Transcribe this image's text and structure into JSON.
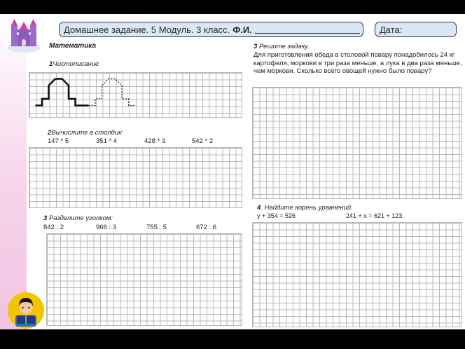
{
  "header": {
    "title_prefix": "Домашнее задание. 5 Модуль. 3 класс.",
    "name_label": "Ф.И.",
    "date_label": "Дата:"
  },
  "subject": "Математика",
  "task1": {
    "number": "1",
    "title": "Чистописание"
  },
  "task2": {
    "number": "2",
    "title": "Вычислите в столбик:",
    "expressions": [
      "147 * 5",
      "351 * 4",
      "428 * 3",
      "542 * 2"
    ]
  },
  "task3left": {
    "number": "3",
    "title": "Разделите уголком:",
    "expressions": [
      "842 : 2",
      "966 : 3",
      "755 : 5",
      "672 : 6"
    ]
  },
  "task3right": {
    "number": "3",
    "title": "Решите задачу.",
    "text": "Для приготовления обеда в столовой повару понадобилось 24 кг картофеля, моркови в три раза меньше, а лука в два раза меньше, чем моркови. Сколько всего овощей нужно было повару?"
  },
  "task4": {
    "number": "4",
    "title": "Найдите корень уравнений.",
    "equations": [
      "у + 354 = 526",
      "241 + х = 621 + 123"
    ]
  },
  "colors": {
    "header_bg": "#dbe7f5",
    "header_border": "#2f3b55",
    "strip": "#f1c4e2",
    "grid": "#b8b8b8",
    "avatar_bg": "#f5c400"
  },
  "icons": {
    "logo": "castle-icon",
    "avatar": "reading-student-icon"
  }
}
